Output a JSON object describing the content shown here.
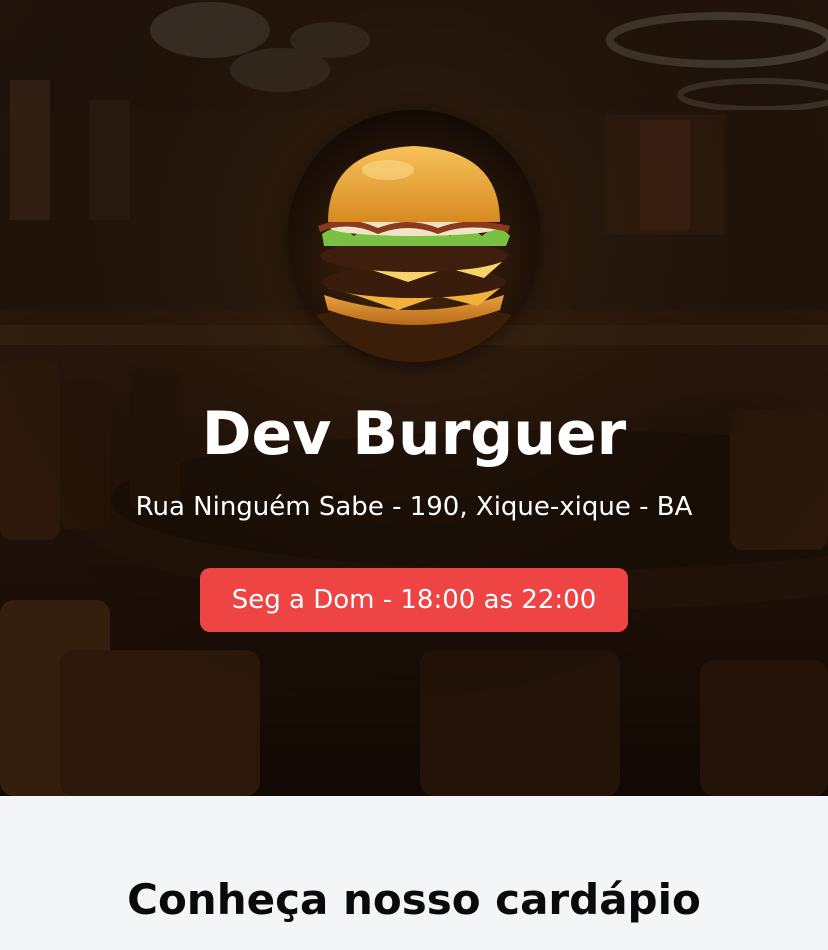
{
  "hero": {
    "background_icon": "restaurant-interior-image",
    "logo_icon": "burger-image",
    "title": "Dev Burguer",
    "address": "Rua Ninguém Sabe - 190, Xique-xique - BA",
    "hours": "Seg a Dom - 18:00 as 22:00"
  },
  "menu": {
    "title": "Conheça nosso cardápio"
  },
  "colors": {
    "accent": "#ef4444",
    "hero_text": "#ffffff",
    "section_bg": "#f4f5f7",
    "heading_text": "#0a0a0a"
  }
}
